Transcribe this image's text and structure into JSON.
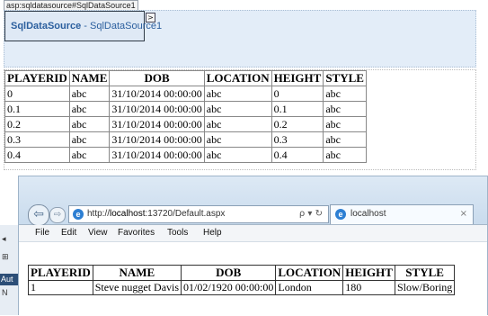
{
  "designer": {
    "tag_label": "asp:sqldatasource#SqlDataSource1",
    "ds_type": "SqlDataSource",
    "ds_sep": " - ",
    "ds_id": "SqlDataSource1",
    "smart_tag_icon": "chevron-right-icon",
    "smart_tag_glyph": ">",
    "grid": {
      "headers": [
        "PLAYERID",
        "NAME",
        "DOB",
        "LOCATION",
        "HEIGHT",
        "STYLE"
      ],
      "rows": [
        [
          "0",
          "abc",
          "31/10/2014 00:00:00",
          "abc",
          "0",
          "abc"
        ],
        [
          "0.1",
          "abc",
          "31/10/2014 00:00:00",
          "abc",
          "0.1",
          "abc"
        ],
        [
          "0.2",
          "abc",
          "31/10/2014 00:00:00",
          "abc",
          "0.2",
          "abc"
        ],
        [
          "0.3",
          "abc",
          "31/10/2014 00:00:00",
          "abc",
          "0.3",
          "abc"
        ],
        [
          "0.4",
          "abc",
          "31/10/2014 00:00:00",
          "abc",
          "0.4",
          "abc"
        ]
      ]
    }
  },
  "browser": {
    "back_glyph": "⇦",
    "forward_glyph": "⇨",
    "address_prefix": "http://",
    "address_host": "localhost",
    "address_rest": ":13720/Default.aspx",
    "address_tools": "ρ ▾ ↻",
    "tab_title": "localhost",
    "tab_close": "×",
    "ie_glyph": "e",
    "menu": [
      "File",
      "Edit",
      "View",
      "Favorites",
      "Tools",
      "Help"
    ],
    "grid": {
      "headers": [
        "PLAYERID",
        "NAME",
        "DOB",
        "LOCATION",
        "HEIGHT",
        "STYLE"
      ],
      "rows": [
        [
          "1",
          "Steve nugget Davis",
          "01/02/1920 00:00:00",
          "London",
          "180",
          "Slow/Boring"
        ]
      ]
    }
  },
  "left_strip": {
    "items": [
      "◂",
      "⊞"
    ],
    "aut_label": "Aut",
    "n_label": "N"
  }
}
